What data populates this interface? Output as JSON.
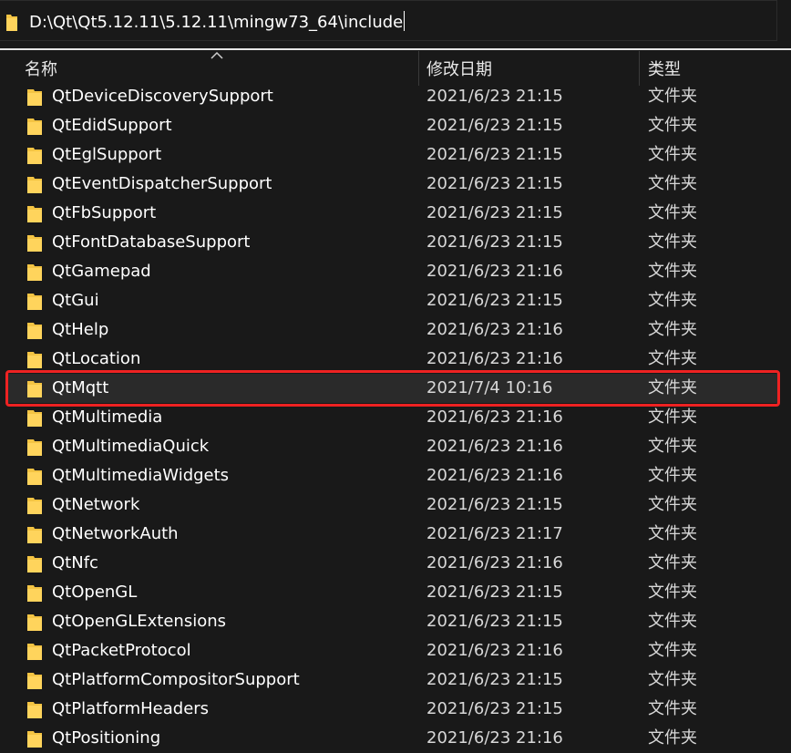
{
  "address_bar": {
    "path": "D:\\Qt\\Qt5.12.11\\5.12.11\\mingw73_64\\include"
  },
  "columns": {
    "name": "名称",
    "date": "修改日期",
    "type": "类型"
  },
  "files": [
    {
      "name": "QtDeviceDiscoverySupport",
      "date": "2021/6/23 21:15",
      "type": "文件夹"
    },
    {
      "name": "QtEdidSupport",
      "date": "2021/6/23 21:15",
      "type": "文件夹"
    },
    {
      "name": "QtEglSupport",
      "date": "2021/6/23 21:15",
      "type": "文件夹"
    },
    {
      "name": "QtEventDispatcherSupport",
      "date": "2021/6/23 21:15",
      "type": "文件夹"
    },
    {
      "name": "QtFbSupport",
      "date": "2021/6/23 21:15",
      "type": "文件夹"
    },
    {
      "name": "QtFontDatabaseSupport",
      "date": "2021/6/23 21:15",
      "type": "文件夹"
    },
    {
      "name": "QtGamepad",
      "date": "2021/6/23 21:16",
      "type": "文件夹"
    },
    {
      "name": "QtGui",
      "date": "2021/6/23 21:15",
      "type": "文件夹"
    },
    {
      "name": "QtHelp",
      "date": "2021/6/23 21:16",
      "type": "文件夹"
    },
    {
      "name": "QtLocation",
      "date": "2021/6/23 21:16",
      "type": "文件夹"
    },
    {
      "name": "QtMqtt",
      "date": "2021/7/4 10:16",
      "type": "文件夹"
    },
    {
      "name": "QtMultimedia",
      "date": "2021/6/23 21:16",
      "type": "文件夹"
    },
    {
      "name": "QtMultimediaQuick",
      "date": "2021/6/23 21:16",
      "type": "文件夹"
    },
    {
      "name": "QtMultimediaWidgets",
      "date": "2021/6/23 21:16",
      "type": "文件夹"
    },
    {
      "name": "QtNetwork",
      "date": "2021/6/23 21:15",
      "type": "文件夹"
    },
    {
      "name": "QtNetworkAuth",
      "date": "2021/6/23 21:17",
      "type": "文件夹"
    },
    {
      "name": "QtNfc",
      "date": "2021/6/23 21:16",
      "type": "文件夹"
    },
    {
      "name": "QtOpenGL",
      "date": "2021/6/23 21:15",
      "type": "文件夹"
    },
    {
      "name": "QtOpenGLExtensions",
      "date": "2021/6/23 21:15",
      "type": "文件夹"
    },
    {
      "name": "QtPacketProtocol",
      "date": "2021/6/23 21:16",
      "type": "文件夹"
    },
    {
      "name": "QtPlatformCompositorSupport",
      "date": "2021/6/23 21:15",
      "type": "文件夹"
    },
    {
      "name": "QtPlatformHeaders",
      "date": "2021/6/23 21:15",
      "type": "文件夹"
    },
    {
      "name": "QtPositioning",
      "date": "2021/6/23 21:16",
      "type": "文件夹"
    }
  ],
  "highlighted_file": "QtMqtt",
  "colors": {
    "background": "#191919",
    "folder": "#f4c443",
    "highlight_border": "#ee2222"
  }
}
